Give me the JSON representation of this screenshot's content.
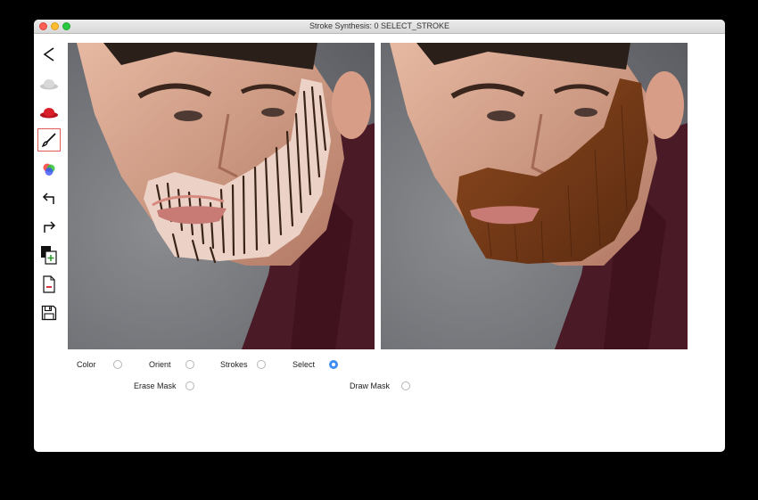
{
  "window": {
    "title": "Stroke Synthesis: 0 SELECT_STROKE"
  },
  "toolbar": {
    "tools": [
      {
        "icon": "back-arrow-icon"
      },
      {
        "icon": "gray-hat-icon"
      },
      {
        "icon": "red-hat-icon"
      },
      {
        "icon": "brush-icon",
        "selected": true
      },
      {
        "icon": "color-circles-icon"
      },
      {
        "icon": "undo-icon"
      },
      {
        "icon": "redo-icon"
      },
      {
        "icon": "new-layer-icon"
      },
      {
        "icon": "delete-file-icon"
      },
      {
        "icon": "save-icon"
      }
    ]
  },
  "canvases": {
    "left": {
      "content": "input portrait with drawn beard strokes"
    },
    "right": {
      "content": "synthesized portrait with full beard"
    }
  },
  "options": {
    "color": {
      "label": "Color",
      "checked": false
    },
    "orient": {
      "label": "Orient",
      "checked": false
    },
    "strokes": {
      "label": "Strokes",
      "checked": false
    },
    "select": {
      "label": "Select",
      "checked": true
    },
    "erase_mask": {
      "label": "Erase Mask",
      "checked": false
    },
    "draw_mask": {
      "label": "Draw Mask",
      "checked": false
    }
  },
  "colors": {
    "accent": "#3f8ef2",
    "selected_tool_border": "#e25a5a",
    "shirt": "#4a1a26",
    "beard": "#7a3b16",
    "mask": "#ecd2c6"
  }
}
